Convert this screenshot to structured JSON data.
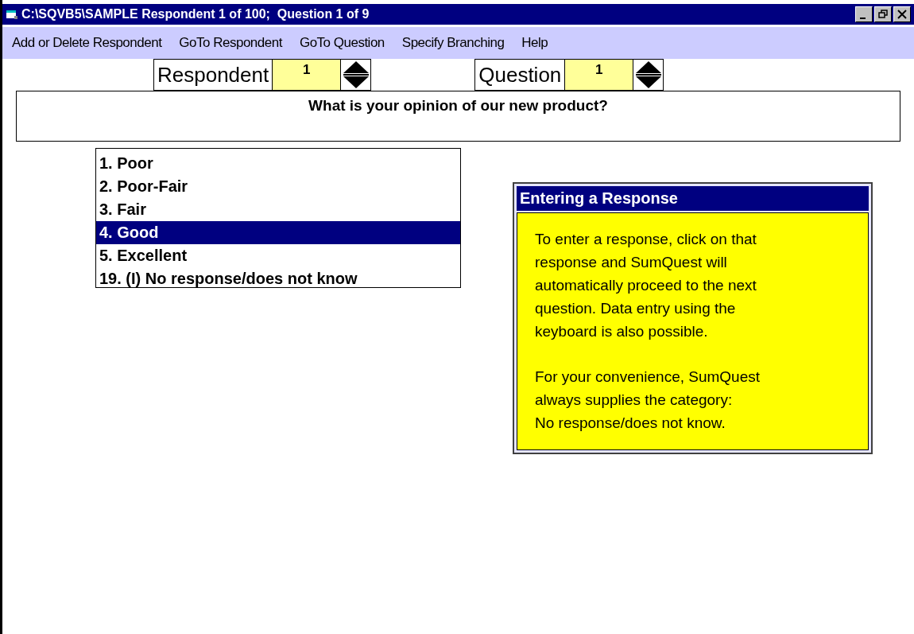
{
  "window": {
    "title": "C:\\SQVB5\\SAMPLE Respondent 1 of 100;  Question 1 of 9"
  },
  "menu": [
    "Add or Delete Respondent",
    "GoTo Respondent",
    "GoTo Question",
    "Specify Branching",
    "Help"
  ],
  "spinners": [
    {
      "label": "Respondent",
      "value": "1"
    },
    {
      "label": "Question",
      "value": "1"
    }
  ],
  "question": "What is your opinion of our new product?",
  "responses": [
    {
      "label": "1. Poor",
      "selected": false
    },
    {
      "label": "2. Poor-Fair",
      "selected": false
    },
    {
      "label": "3. Fair",
      "selected": false
    },
    {
      "label": "4. Good",
      "selected": true
    },
    {
      "label": "5. Excellent",
      "selected": false
    },
    {
      "label": "19. (I) No response/does not know",
      "selected": false
    }
  ],
  "help_panel": {
    "title": "Entering a Response",
    "paragraphs": [
      "To enter a response, click on that\nresponse and SumQuest will\nautomatically proceed to the next\nquestion.  Data entry using the\nkeyboard is also possible.",
      "For your convenience, SumQuest\nalways supplies the category:\nNo response/does not know."
    ]
  }
}
